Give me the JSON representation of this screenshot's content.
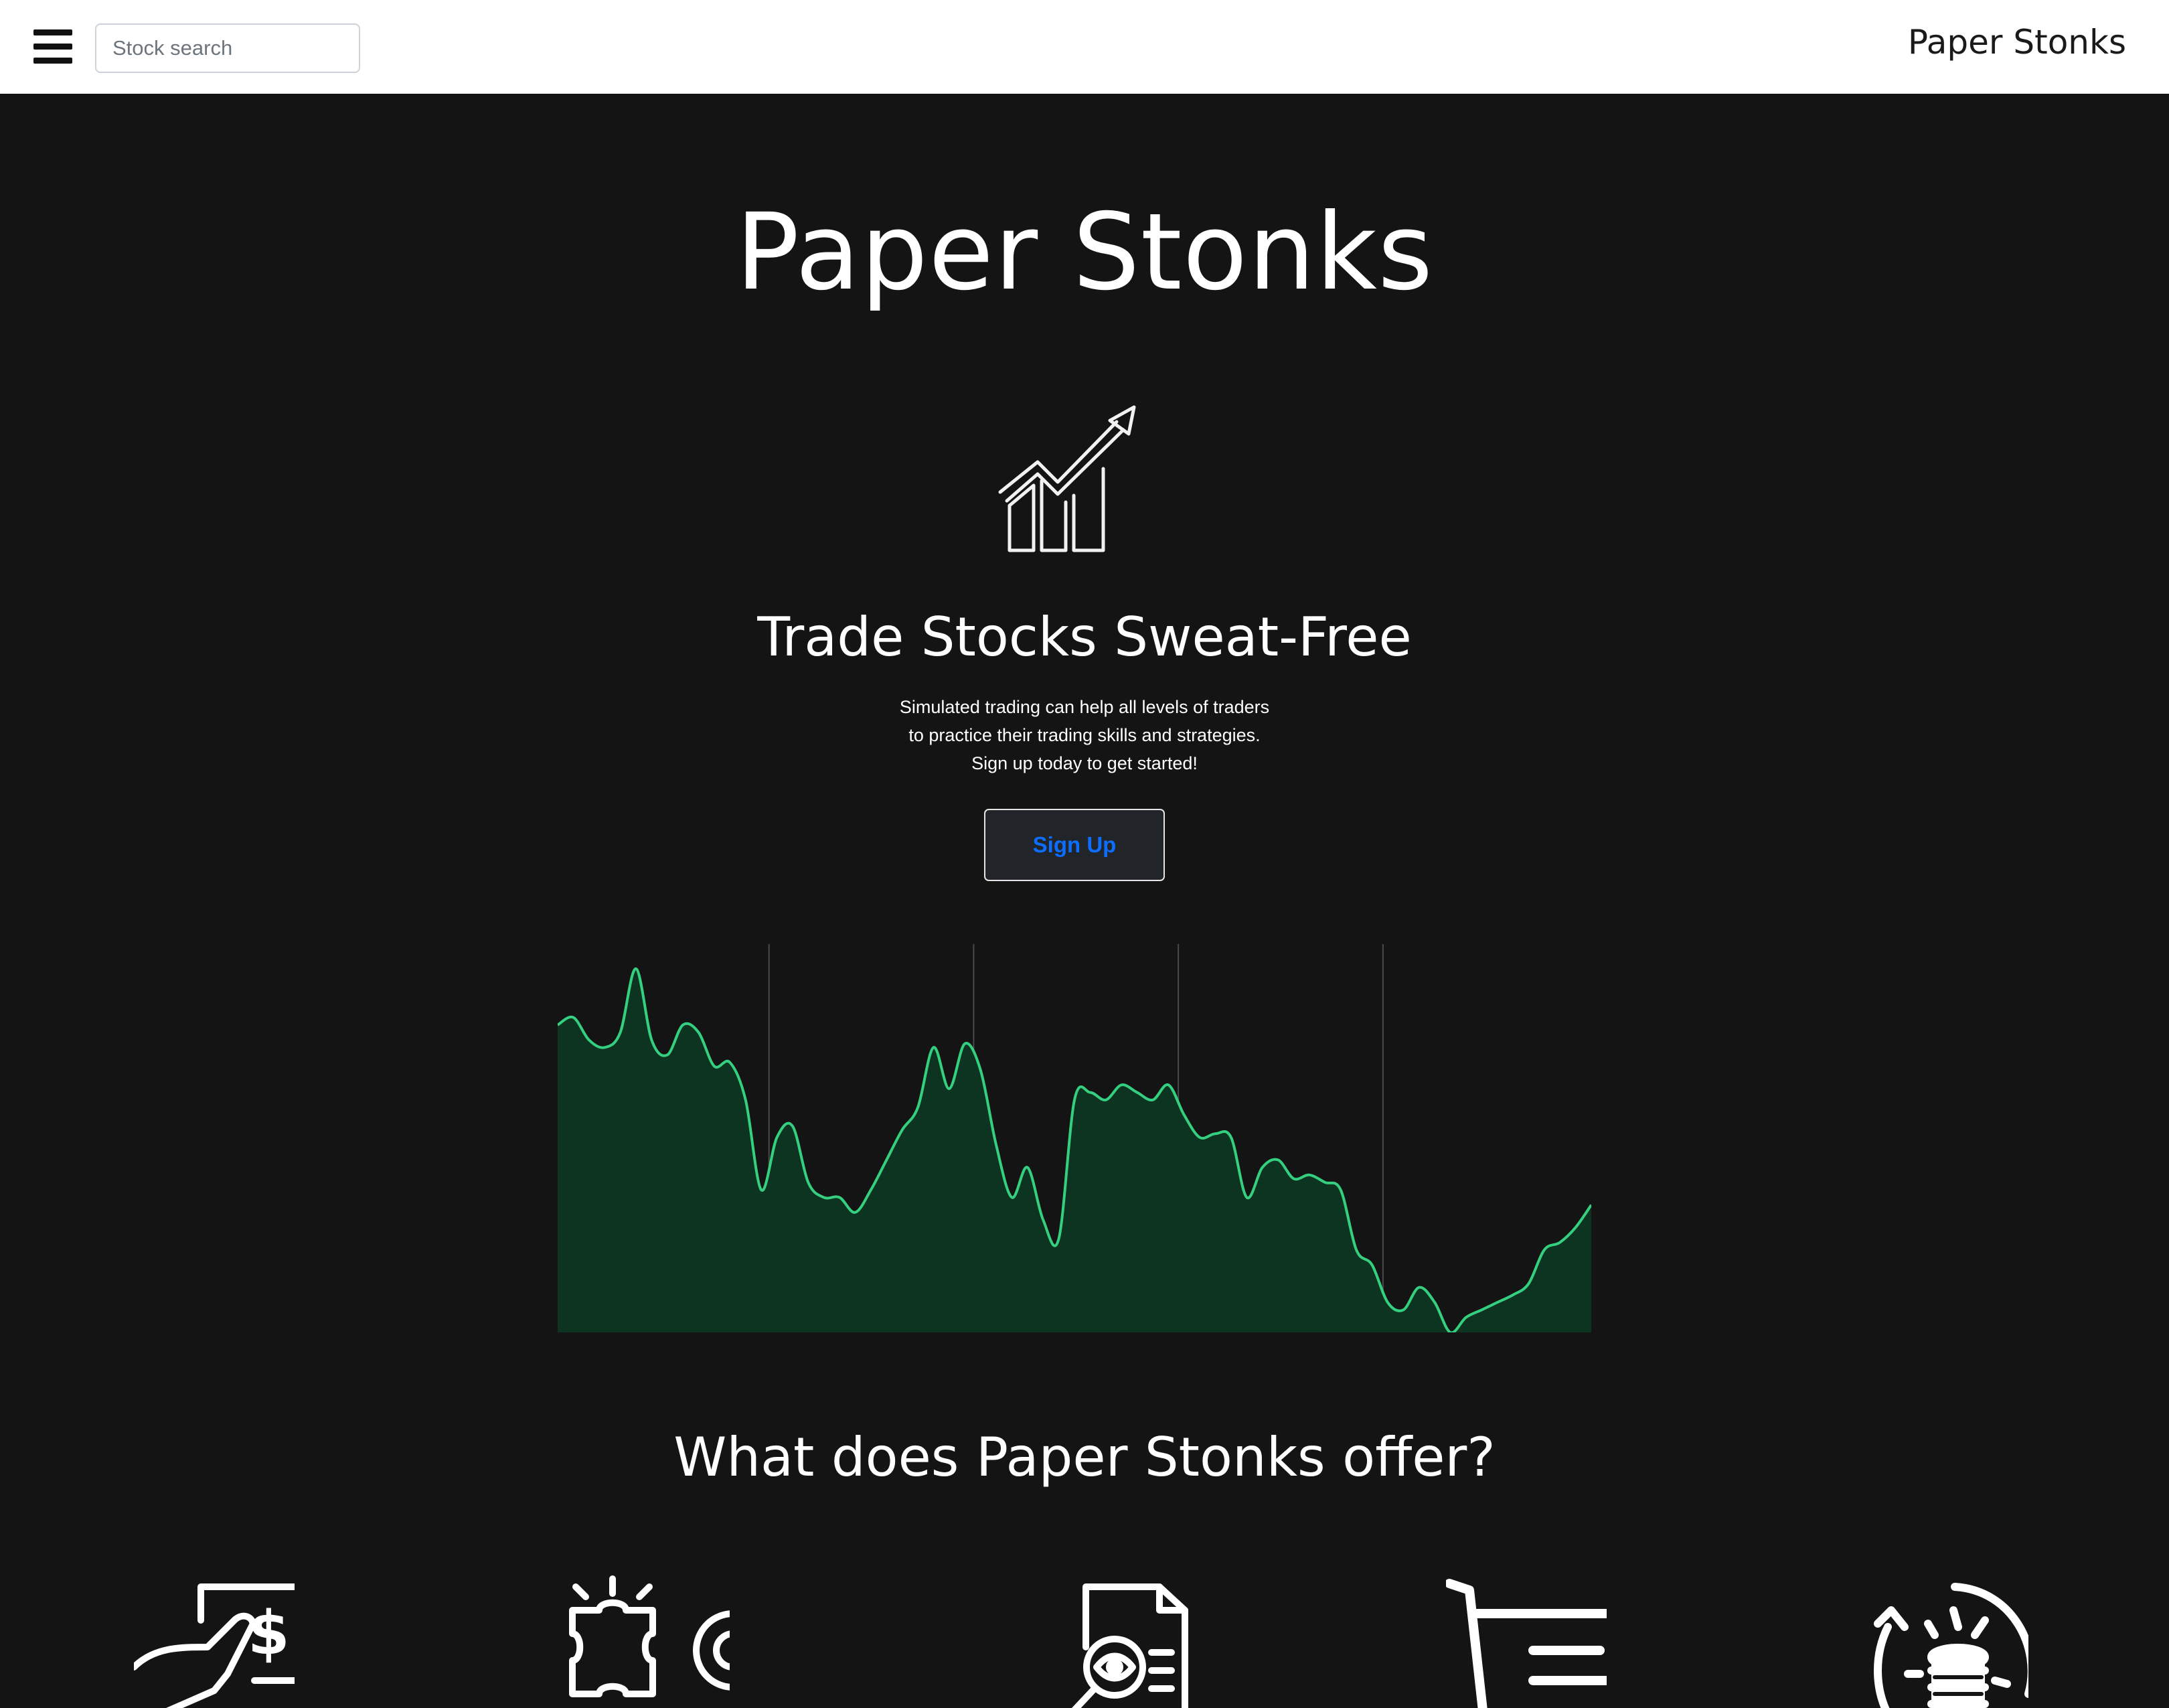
{
  "navbar": {
    "search_placeholder": "Stock search",
    "brand": "Paper Stonks",
    "menu_icon": "hamburger-menu-icon"
  },
  "hero": {
    "title": "Paper Stonks",
    "icon": "growth-chart-arrow-icon",
    "tagline": "Trade Stocks Sweat-Free",
    "description_lines": [
      "Simulated trading can help all levels of traders",
      "to practice their trading skills and strategies.",
      "Sign up today to get started!"
    ],
    "signup_label": "Sign Up"
  },
  "chart_data": {
    "type": "area",
    "title": "",
    "xlabel": "",
    "ylabel": "",
    "ylim": [
      0,
      100
    ],
    "grid": "vertical lines",
    "colors": {
      "line": "#35d07f",
      "fill": "#0d3321"
    },
    "series": [
      {
        "values": [
          82,
          84,
          78,
          76,
          80,
          97,
          78,
          74,
          82,
          80,
          71,
          72,
          62,
          38,
          52,
          55,
          40,
          36,
          36,
          32,
          38,
          46,
          54,
          60,
          76,
          65,
          77,
          70,
          50,
          36,
          44,
          30,
          25,
          62,
          64,
          62,
          66,
          64,
          62,
          66,
          58,
          52,
          53,
          52,
          36,
          44,
          46,
          41,
          42,
          40,
          38,
          22,
          18,
          8,
          6,
          12,
          8,
          0,
          4,
          6,
          8,
          10,
          13,
          22,
          24,
          28,
          34
        ]
      }
    ]
  },
  "offer": {
    "title": "What does Paper Stonks offer?",
    "features": [
      {
        "icon": "cash-hand-icon"
      },
      {
        "icon": "puzzle-gear-icon"
      },
      {
        "icon": "document-search-icon"
      },
      {
        "icon": "shopping-cart-icon"
      },
      {
        "icon": "coins-refresh-icon"
      }
    ]
  }
}
